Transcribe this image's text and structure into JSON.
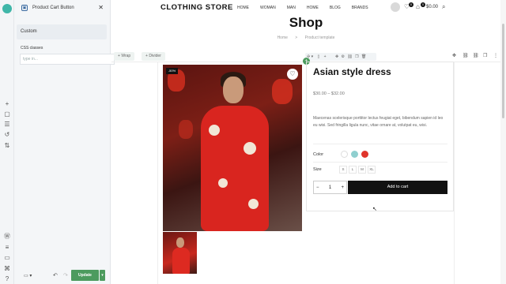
{
  "editor": {
    "panel_title": "Product Cart Button",
    "custom_label": "Custom",
    "css_classes_label": "CSS classes",
    "css_input_placeholder": "type in...",
    "update_label": "Update"
  },
  "site": {
    "brand": "CLOTHING STORE",
    "nav": [
      "HOME",
      "WOMAN",
      "MAN",
      "HOME",
      "BLOG",
      "BRANDS"
    ],
    "wishlist_count": "0",
    "cart_count": "0",
    "cart_total": "$0.00"
  },
  "page": {
    "title": "Shop",
    "breadcrumb_home": "Home",
    "breadcrumb_sep": ">",
    "breadcrumb_current": "Product template",
    "wrap_label": "Wrap",
    "divider_label": "Divider"
  },
  "product": {
    "sale_badge": "-50%",
    "title": "Asian style dress",
    "price": "$30.00 – $32.00",
    "description": "Maecenas scelerisque porttitor lectus feugiat eget, bibendum sapien id leo eu wisi. Sed fringilla ligula nunc, vitae ornare at, volutpat eu, wisi.",
    "color_label": "Color",
    "size_label": "Size",
    "sizes": [
      "S",
      "L",
      "M",
      "XL"
    ],
    "quantity": "1",
    "add_to_cart_label": "Add to cart"
  },
  "colors": {
    "accent_green": "#4c9b5e",
    "swatch_white": "#ffffff",
    "swatch_teal": "#8fcfcf",
    "swatch_red": "#e0352b"
  }
}
